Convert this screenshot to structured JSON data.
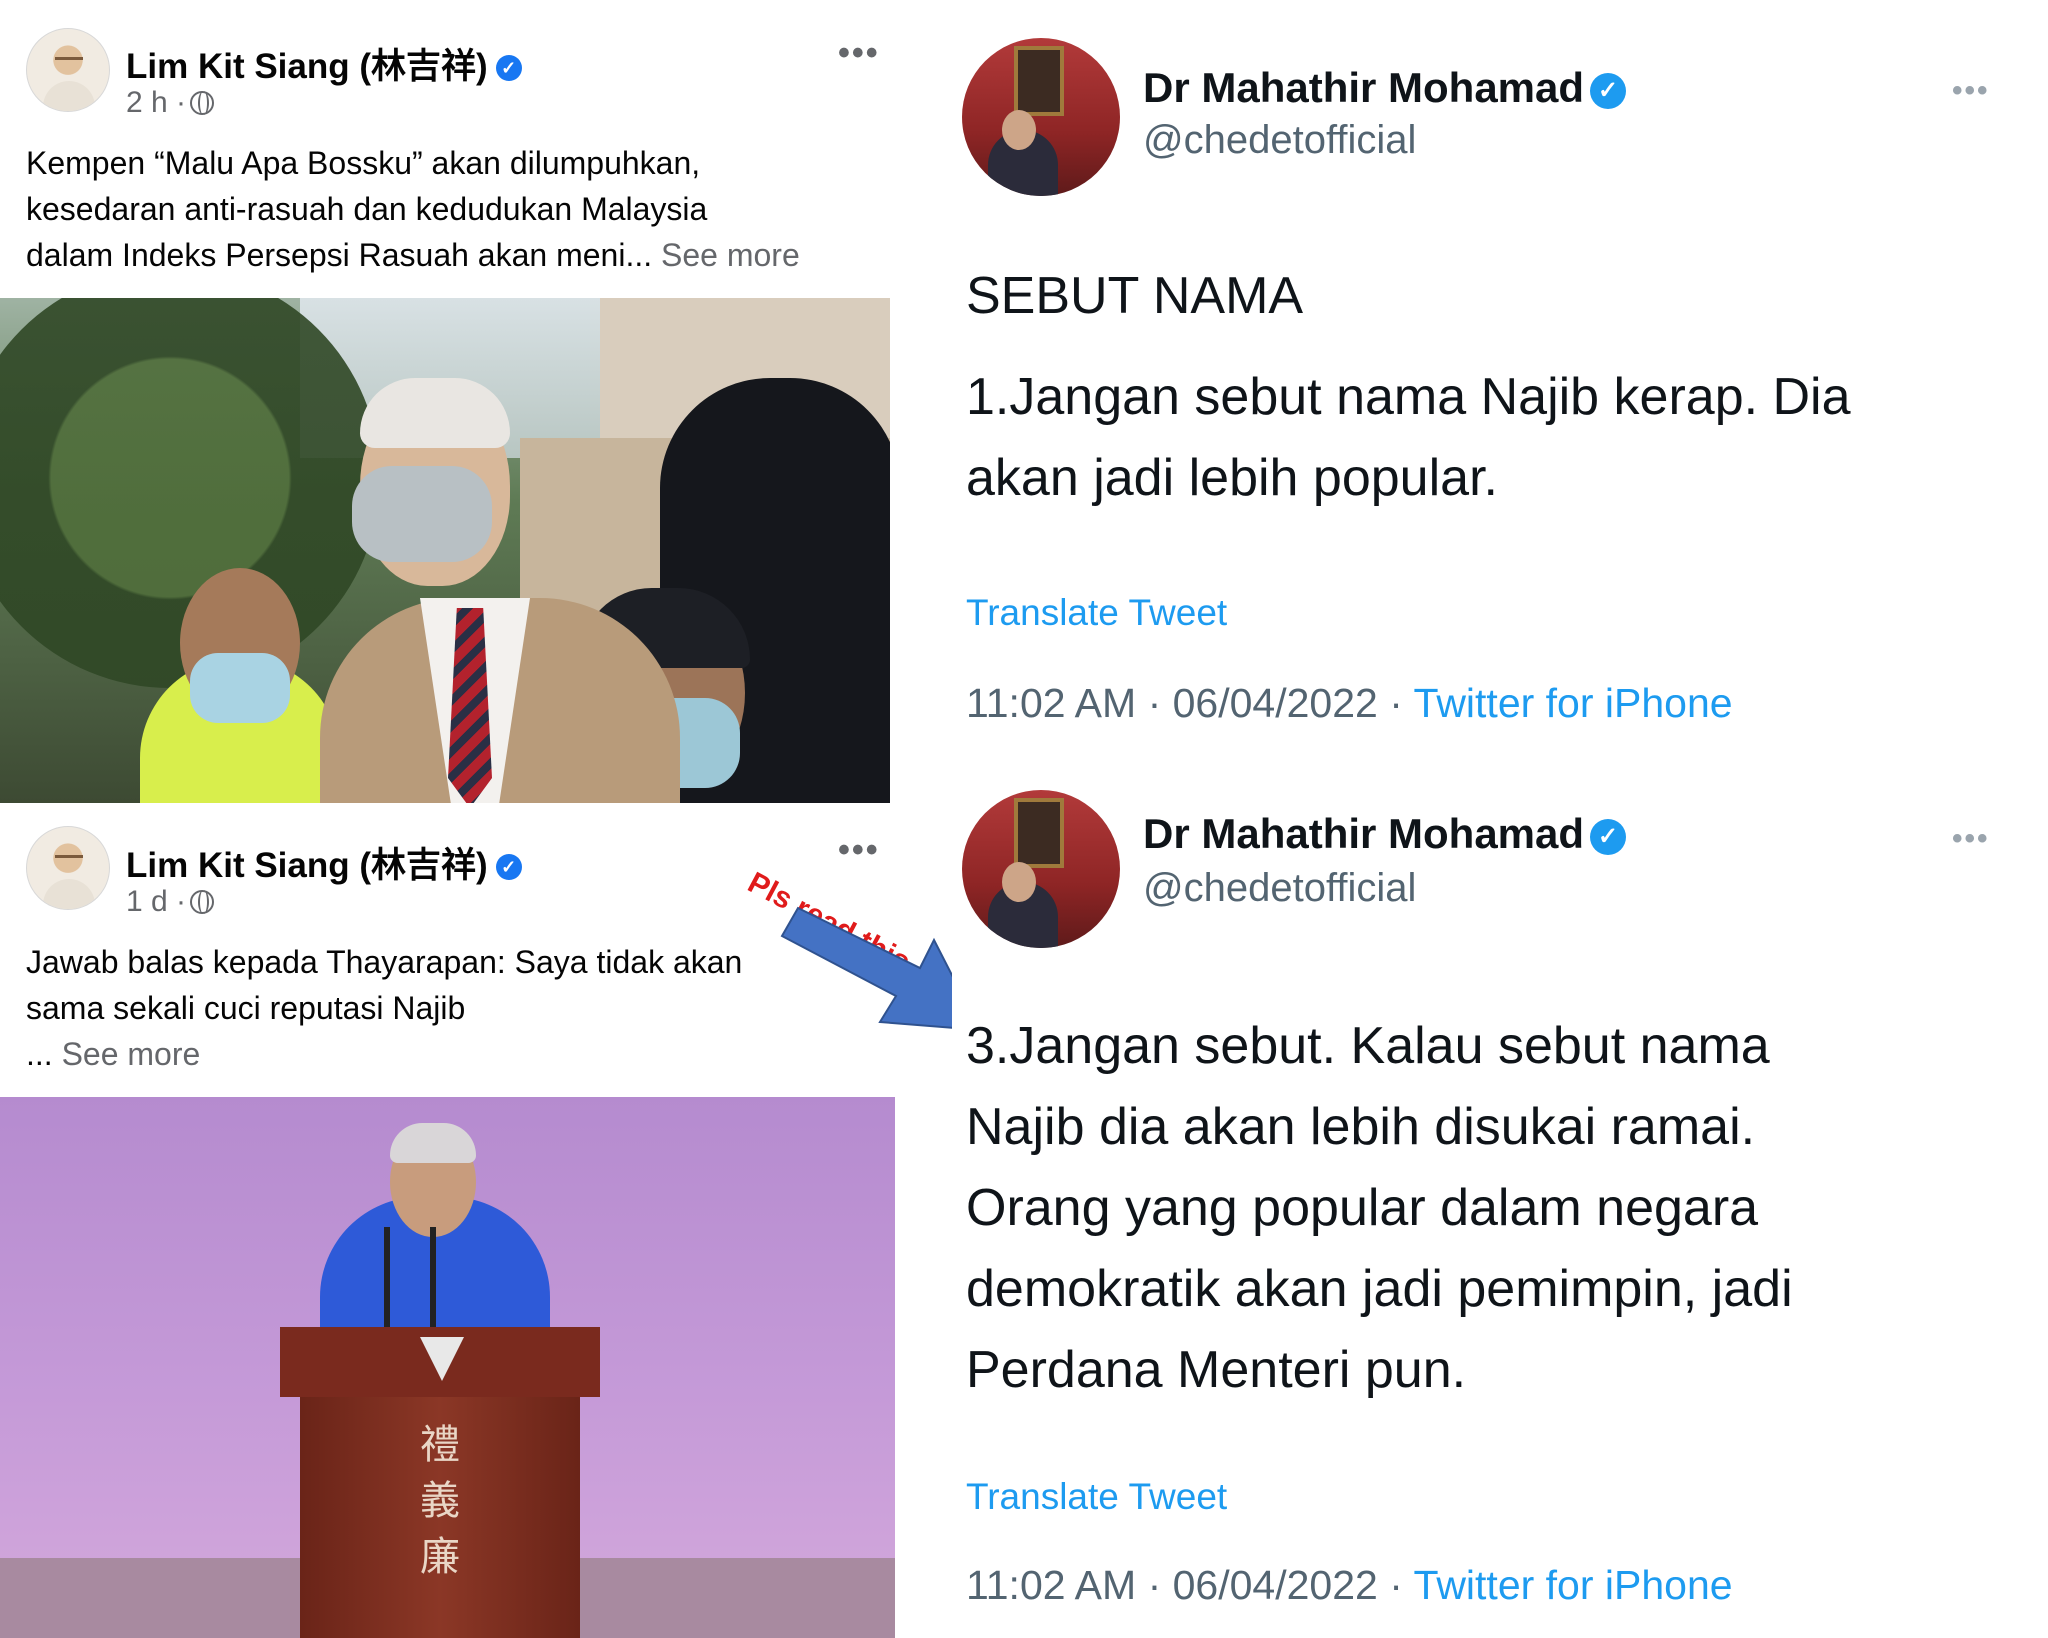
{
  "facebook": {
    "posts": [
      {
        "author": "Lim Kit Siang (林吉祥)",
        "time": "2 h ·",
        "text_lines": [
          "Kempen “Malu Apa Bossku” akan dilumpuhkan,",
          "kesedaran anti-rasuah dan kedudukan Malaysia",
          "dalam Indeks Persepsi Rasuah akan meni..."
        ],
        "see_more": "See more"
      },
      {
        "author": "Lim Kit Siang (林吉祥)",
        "time": "1 d ·",
        "text_lines": [
          "Jawab balas kepada Thayarapan: Saya tidak akan",
          "sama sekali cuci reputasi Najib",
          "..."
        ],
        "see_more": "See more",
        "podium_chars": "禮義廉"
      }
    ],
    "verified_glyph": "✓",
    "more_glyph": "•••"
  },
  "annotation": {
    "text": "Pls read this.",
    "text_color": "#e01b1b",
    "arrow_color": "#4472c4"
  },
  "twitter": {
    "tweets": [
      {
        "name": "Dr Mahathir Mohamad",
        "handle": "@chedetofficial",
        "body_lines": [
          "SEBUT NAMA",
          "",
          "1.Jangan sebut nama Najib kerap. Dia",
          "akan jadi lebih popular."
        ],
        "translate": "Translate Tweet",
        "timestamp": "11:02 AM · 06/04/2022 · ",
        "source": "Twitter for iPhone"
      },
      {
        "name": "Dr Mahathir Mohamad",
        "handle": "@chedetofficial",
        "body_lines": [
          "3.Jangan sebut. Kalau sebut nama",
          "Najib dia akan lebih disukai ramai.",
          "Orang yang popular dalam negara",
          "demokratik akan jadi pemimpin, jadi",
          "Perdana Menteri pun."
        ],
        "translate": "Translate Tweet",
        "timestamp": "11:02 AM · 06/04/2022 · ",
        "source": "Twitter for iPhone"
      }
    ],
    "verified_glyph": "✓",
    "more_glyph": "•••"
  },
  "colors": {
    "facebook_blue": "#1877f2",
    "twitter_blue": "#1d9bf0",
    "secondary_text": "#65676b"
  }
}
